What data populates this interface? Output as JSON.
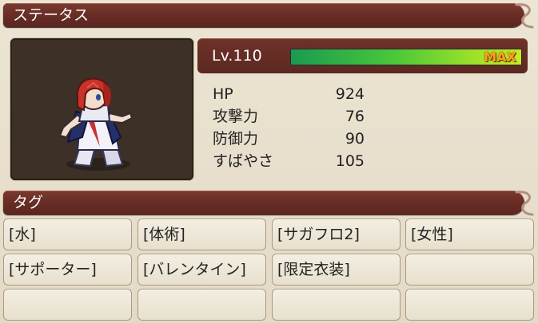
{
  "status_header": {
    "title": "ステータス"
  },
  "level": {
    "label": "Lv.110",
    "exp_fraction": 1.0,
    "max_label": "MAX"
  },
  "stats": [
    {
      "label": "HP",
      "value": "924"
    },
    {
      "label": "攻撃力",
      "value": "76"
    },
    {
      "label": "防御力",
      "value": "90"
    },
    {
      "label": "すばやさ",
      "value": "105"
    }
  ],
  "tags_header": {
    "title": "タグ"
  },
  "tags": [
    "[水]",
    "[体術]",
    "[サガフロ2]",
    "[女性]",
    "[サポーター]",
    "[バレンタイン]",
    "[限定衣装]",
    "",
    "",
    "",
    "",
    ""
  ],
  "colors": {
    "header": "#6a2e26",
    "panel": "#e9e1cf",
    "max_label": "#f6a21c",
    "exp_bar_start": "#1a9a50",
    "exp_bar_end": "#c8ec28"
  }
}
